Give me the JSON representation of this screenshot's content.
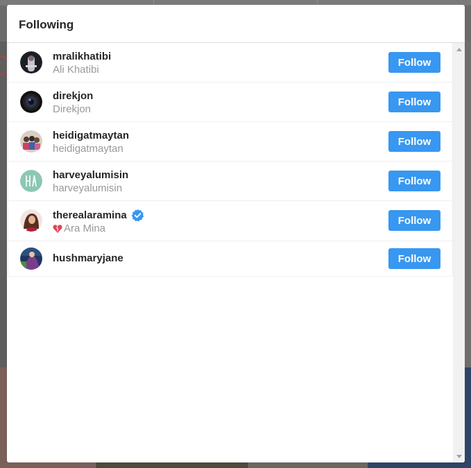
{
  "modal": {
    "title": "Following"
  },
  "users": [
    {
      "username": "mralikhatibi",
      "fullname": "Ali Khatibi",
      "verified": false,
      "heart": false,
      "avatar_icon": "person-avatar-icon",
      "follow_label": "Follow"
    },
    {
      "username": "direkjon",
      "fullname": "Direkjon",
      "verified": false,
      "heart": false,
      "avatar_icon": "camera-lens-avatar-icon",
      "follow_label": "Follow"
    },
    {
      "username": "heidigatmaytan",
      "fullname": "heidigatmaytan",
      "verified": false,
      "heart": false,
      "avatar_icon": "group-photo-avatar-icon",
      "follow_label": "Follow"
    },
    {
      "username": "harveyalumisin",
      "fullname": "harveyalumisin",
      "verified": false,
      "heart": false,
      "avatar_icon": "monogram-ha-avatar-icon",
      "follow_label": "Follow"
    },
    {
      "username": "therealaramina",
      "fullname": "Ara Mina",
      "verified": true,
      "heart": true,
      "avatar_icon": "person-avatar-icon",
      "follow_label": "Follow"
    },
    {
      "username": "hushmaryjane",
      "fullname": "",
      "verified": false,
      "heart": false,
      "avatar_icon": "photo-avatar-icon",
      "follow_label": "Follow"
    }
  ],
  "colors": {
    "follow_button": "#3897f0",
    "verified_badge": "#3897f0",
    "username": "#262626",
    "fullname": "#999999"
  }
}
